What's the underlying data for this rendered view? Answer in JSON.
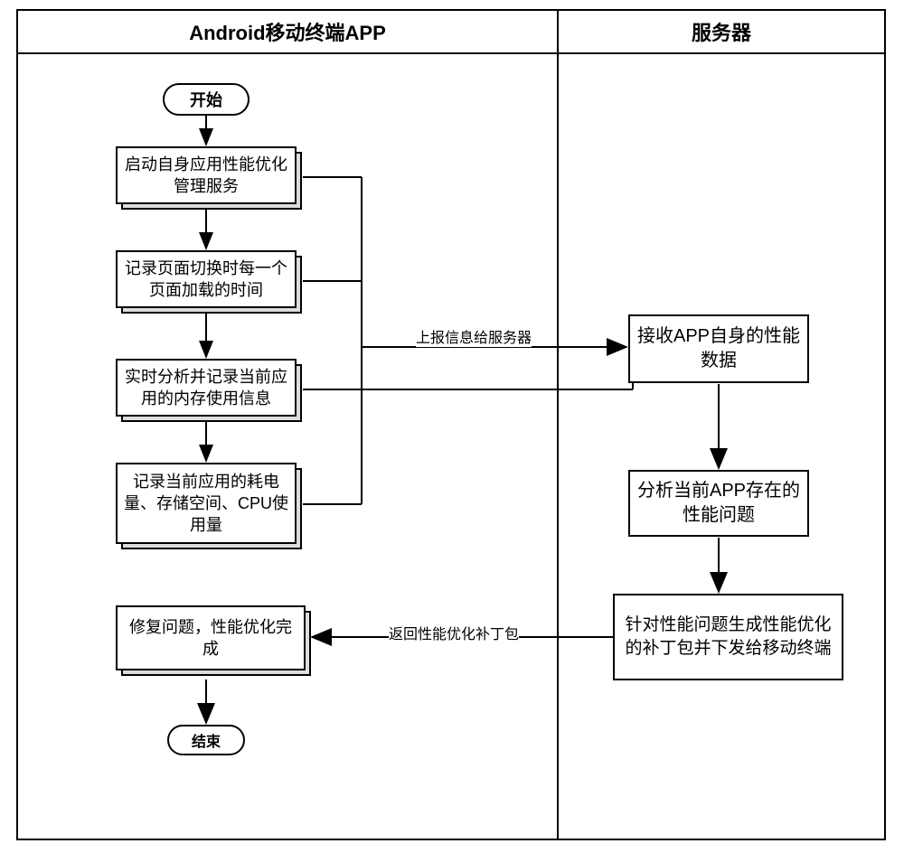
{
  "headers": {
    "left": "Android移动终端APP",
    "right": "服务器"
  },
  "left_lane": {
    "start": "开始",
    "step1": "启动自身应用性能优化管理服务",
    "step2": "记录页面切换时每一个页面加载的时间",
    "step3": "实时分析并记录当前应用的内存使用信息",
    "step4": "记录当前应用的耗电量、存储空间、CPU使用量",
    "step5": "修复问题，性能优化完成",
    "end": "结束"
  },
  "right_lane": {
    "r1": "接收APP自身的性能数据",
    "r2": "分析当前APP存在的性能问题",
    "r3": "针对性能问题生成性能优化的补丁包并下发给移动终端"
  },
  "labels": {
    "upload": "上报信息给服务器",
    "return": "返回性能优化补丁包"
  },
  "chart_data": {
    "type": "flowchart",
    "swimlanes": [
      {
        "id": "app",
        "title": "Android移动终端APP"
      },
      {
        "id": "server",
        "title": "服务器"
      }
    ],
    "nodes": [
      {
        "id": "start",
        "lane": "app",
        "type": "terminator",
        "label": "开始"
      },
      {
        "id": "a1",
        "lane": "app",
        "type": "process",
        "label": "启动自身应用性能优化管理服务"
      },
      {
        "id": "a2",
        "lane": "app",
        "type": "process",
        "label": "记录页面切换时每一个页面加载的时间"
      },
      {
        "id": "a3",
        "lane": "app",
        "type": "process",
        "label": "实时分析并记录当前应用的内存使用信息"
      },
      {
        "id": "a4",
        "lane": "app",
        "type": "process",
        "label": "记录当前应用的耗电量、存储空间、CPU使用量"
      },
      {
        "id": "a5",
        "lane": "app",
        "type": "process",
        "label": "修复问题，性能优化完成"
      },
      {
        "id": "end",
        "lane": "app",
        "type": "terminator",
        "label": "结束"
      },
      {
        "id": "s1",
        "lane": "server",
        "type": "process",
        "label": "接收APP自身的性能数据"
      },
      {
        "id": "s2",
        "lane": "server",
        "type": "process",
        "label": "分析当前APP存在的性能问题"
      },
      {
        "id": "s3",
        "lane": "server",
        "type": "process",
        "label": "针对性能问题生成性能优化的补丁包并下发给移动终端"
      }
    ],
    "edges": [
      {
        "from": "start",
        "to": "a1"
      },
      {
        "from": "a1",
        "to": "a2"
      },
      {
        "from": "a2",
        "to": "a3"
      },
      {
        "from": "a3",
        "to": "a4"
      },
      {
        "from": "a1",
        "to": "s1",
        "via": "a3-right",
        "label": "上报信息给服务器"
      },
      {
        "from": "a2",
        "to": "s1",
        "via": "a3-right",
        "label": "上报信息给服务器"
      },
      {
        "from": "a3",
        "to": "s1",
        "label": "上报信息给服务器"
      },
      {
        "from": "a4",
        "to": "s1",
        "via": "a3-right",
        "label": "上报信息给服务器"
      },
      {
        "from": "s1",
        "to": "s2"
      },
      {
        "from": "s2",
        "to": "s3"
      },
      {
        "from": "s3",
        "to": "a5",
        "label": "返回性能优化补丁包"
      },
      {
        "from": "a5",
        "to": "end"
      }
    ]
  }
}
